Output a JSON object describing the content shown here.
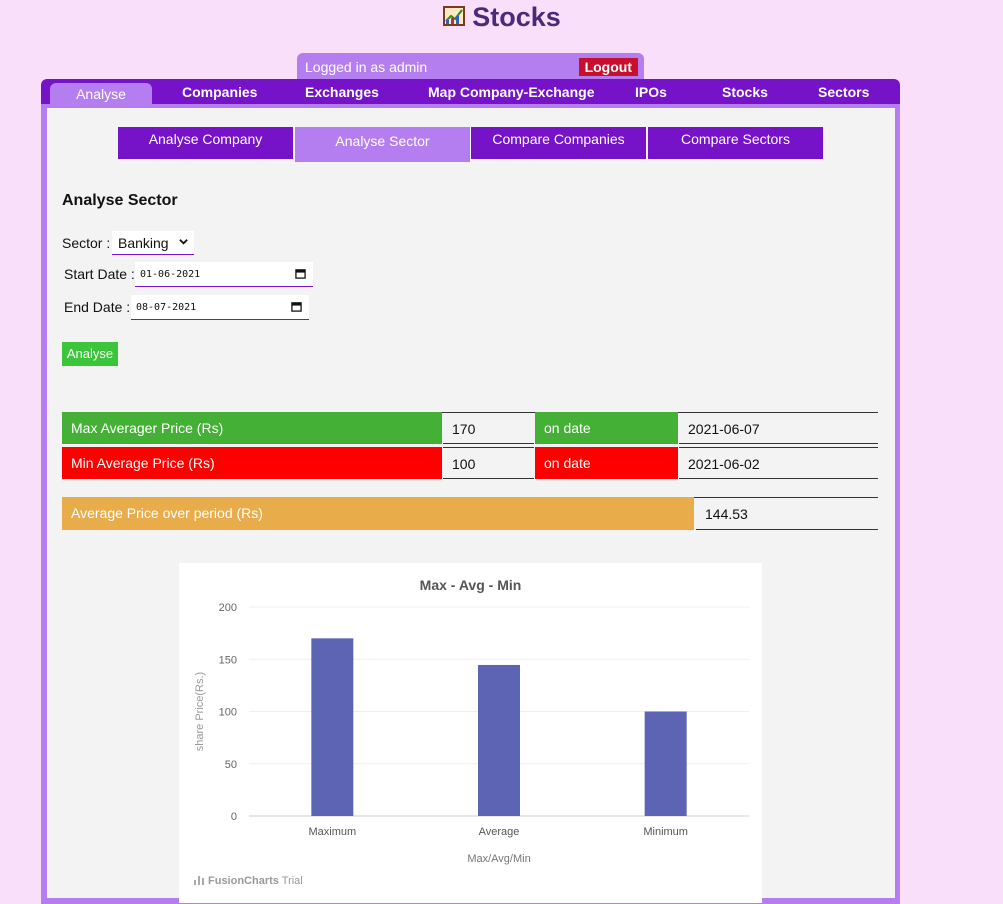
{
  "app": {
    "title": "Stocks",
    "icon": "stock-chart-icon"
  },
  "session": {
    "logged_in_text": "Logged in as admin",
    "logout_label": "Logout"
  },
  "nav": {
    "items": [
      {
        "label": "Analyse",
        "active": true
      },
      {
        "label": "Companies"
      },
      {
        "label": "Exchanges"
      },
      {
        "label": "Map Company-Exchange"
      },
      {
        "label": "IPOs"
      },
      {
        "label": "Stocks"
      },
      {
        "label": "Sectors"
      }
    ]
  },
  "subtabs": [
    {
      "label": "Analyse Company"
    },
    {
      "label": "Analyse Sector",
      "active": true
    },
    {
      "label": "Compare Companies"
    },
    {
      "label": "Compare Sectors"
    }
  ],
  "form": {
    "heading": "Analyse Sector",
    "sector_label": "Sector :",
    "sector_value": "Banking",
    "start_label": "Start Date :",
    "start_value": "01-06-2021",
    "end_label": "End Date :",
    "end_value": "08-07-2021",
    "submit_label": "Analyse"
  },
  "stats": {
    "max_label": "Max Averager Price (Rs)",
    "max_value": "170",
    "max_on": "on date",
    "max_date": "2021-06-07",
    "min_label": "Min Average Price (Rs)",
    "min_value": "100",
    "min_on": "on date",
    "min_date": "2021-06-02",
    "avg_label": "Average Price over period (Rs)",
    "avg_value": "144.53"
  },
  "colors": {
    "accent": "#7612c8",
    "accent_light": "#b57ef0",
    "max_green": "#44b035",
    "min_red": "#ff0000",
    "avg_orange": "#e8ac4a",
    "bar": "#5c64b3"
  },
  "chart_data": {
    "type": "bar",
    "title": "Max - Avg - Min",
    "xlabel": "Max/Avg/Min",
    "ylabel": "share Price(Rs.)",
    "categories": [
      "Maximum",
      "Average",
      "Minimum"
    ],
    "values": [
      170,
      144.53,
      100
    ],
    "ylim": [
      0,
      200
    ],
    "yticks": [
      0,
      50,
      100,
      150,
      200
    ],
    "grid": true,
    "watermark": "FusionCharts",
    "watermark_suffix": "Trial"
  }
}
